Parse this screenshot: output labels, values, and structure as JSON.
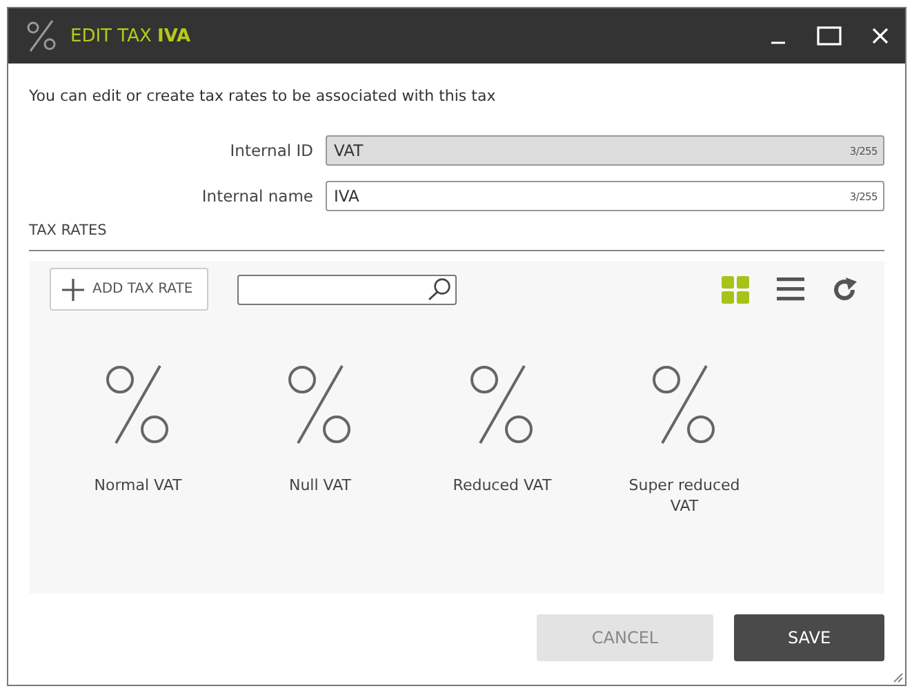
{
  "window": {
    "title": "EDIT TAX **IVA**"
  },
  "description": "You can edit or create tax rates to be associated with this tax",
  "fields": [
    {
      "label": "Internal ID",
      "value": "VAT",
      "counter": "3/255",
      "disabled": true
    },
    {
      "label": "Internal name",
      "value": "IVA",
      "counter": "3/255",
      "disabled": false
    }
  ],
  "section_title": "TAX RATES",
  "toolbar": {
    "add_button": "ADD TAX RATE",
    "views": [
      {
        "kind": "grid",
        "selected": true
      },
      {
        "kind": "list",
        "selected": false
      }
    ]
  },
  "tax_rates": [
    {
      "name": "Normal VAT"
    },
    {
      "name": "Null VAT"
    },
    {
      "name": "Reduced VAT"
    },
    {
      "name": "Super reduced VAT"
    }
  ],
  "buttons": [
    {
      "label": "CANCEL",
      "kind": "secondary"
    },
    {
      "label": "SAVE",
      "kind": "primary"
    }
  ]
}
